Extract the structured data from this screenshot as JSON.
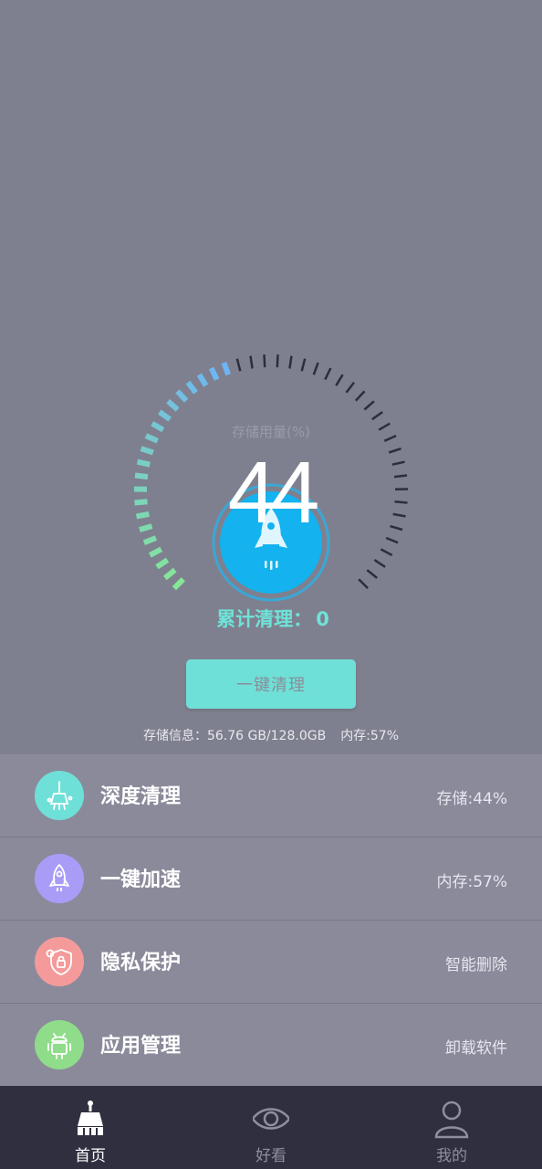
{
  "gauge": {
    "caption": "存储用量(%)",
    "value": "44",
    "percent": 44
  },
  "clean_total": {
    "label": "累计清理：",
    "value": "0"
  },
  "one_key_button": "一键清理",
  "storage_info": {
    "storage": "存储信息：56.76 GB/128.0GB",
    "memory": "内存:57%"
  },
  "features": [
    {
      "title": "深度清理",
      "meta": "存储:44%",
      "icon": "broom-icon",
      "color": "#6fe0d7"
    },
    {
      "title": "一键加速",
      "meta": "内存:57%",
      "icon": "rocket-icon",
      "color": "#a99cf7"
    },
    {
      "title": "隐私保护",
      "meta": "智能删除",
      "icon": "shield-icon",
      "color": "#f49a9a"
    },
    {
      "title": "应用管理",
      "meta": "卸载软件",
      "icon": "android-icon",
      "color": "#8fdc8a"
    }
  ],
  "nav": [
    {
      "label": "首页",
      "icon": "broom-icon",
      "active": true
    },
    {
      "label": "好看",
      "icon": "eye-icon",
      "active": false
    },
    {
      "label": "我的",
      "icon": "user-icon",
      "active": false
    }
  ],
  "colors": {
    "accent": "#6fe3d8",
    "nav_bg": "#2f2f40",
    "nav_active": "#ffffff",
    "nav_inactive": "#8e8f9e"
  }
}
